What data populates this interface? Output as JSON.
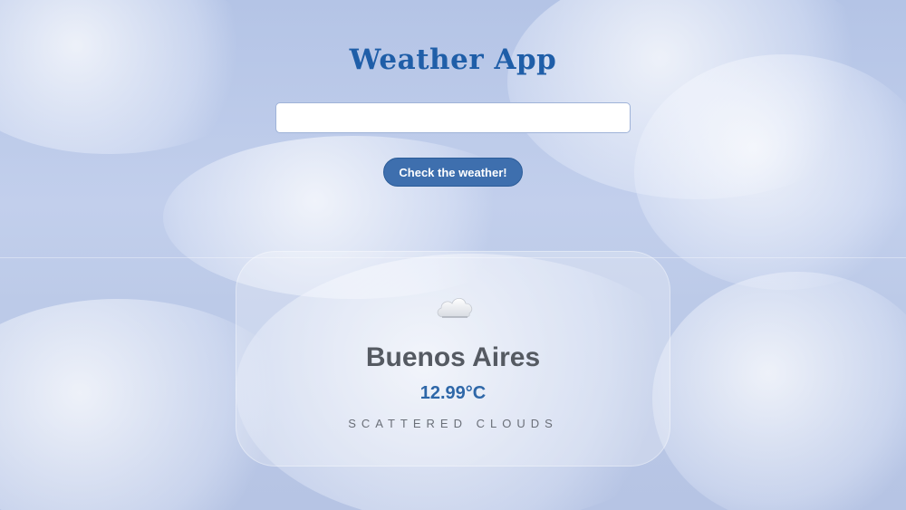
{
  "app": {
    "title": "Weather App"
  },
  "search": {
    "value": "",
    "placeholder": ""
  },
  "actions": {
    "check_label": "Check the weather!"
  },
  "result": {
    "icon": "cloud-icon",
    "city": "Buenos Aires",
    "temperature": "12.99°C",
    "description": "SCATTERED CLOUDS"
  },
  "colors": {
    "title": "#1f5ea8",
    "button": "#3e6fae",
    "temperature": "#2e67a8",
    "city": "#555a62"
  }
}
